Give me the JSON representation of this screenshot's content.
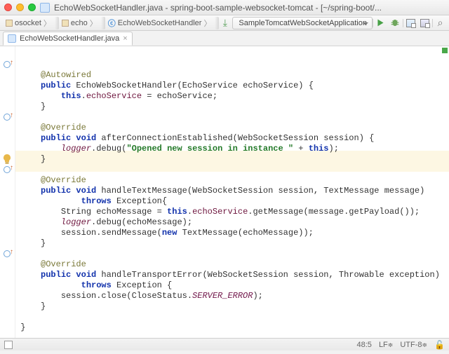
{
  "titlebar": {
    "text": "EchoWebSocketHandler.java - spring-boot-sample-websocket-tomcat - [~/spring-boot/..."
  },
  "breadcrumbs": {
    "b1": "osocket",
    "b2": "echo",
    "b3": "EchoWebSocketHandler"
  },
  "run_config": "SampleTomcatWebSocketApplication",
  "tab": {
    "label": "EchoWebSocketHandler.java"
  },
  "code": {
    "l1_ann": "@Autowired",
    "l2_a": "public",
    "l2_b": " EchoWebSocketHandler(EchoService echoService) {",
    "l3_a": "this",
    "l3_b": ".",
    "l3_c": "echoService",
    "l3_d": " = echoService;",
    "l4": "}",
    "l6_ann": "@Override",
    "l7_a": "public void",
    "l7_b": " afterConnectionEstablished(WebSocketSession session) {",
    "l8_a": "logger",
    "l8_b": ".debug(",
    "l8_c": "\"Opened new session in instance \"",
    "l8_d": " + ",
    "l8_e": "this",
    "l8_f": ");",
    "l9": "}",
    "l11_ann": "@Override",
    "l12_a": "public void",
    "l12_b": " handleTextMessage(WebSocketSession session, TextMessage message)",
    "l13_a": "throws",
    "l13_b": " Exception{",
    "l14_a": "String echoMessage = ",
    "l14_b": "this",
    "l14_c": ".",
    "l14_d": "echoService",
    "l14_e": ".getMessage(message.getPayload());",
    "l15_a": "logger",
    "l15_b": ".debug(echoMessage);",
    "l16_a": "session.sendMessage(",
    "l16_b": "new",
    "l16_c": " TextMessage(echoMessage));",
    "l17": "}",
    "l19_ann": "@Override",
    "l20_a": "public void",
    "l20_b": " handleTransportError(WebSocketSession session, Throwable exception)",
    "l21_a": "throws",
    "l21_b": " Exception {",
    "l22_a": "session.close(CloseStatus.",
    "l22_b": "SERVER_ERROR",
    "l22_c": ");",
    "l23": "}",
    "l25": "}"
  },
  "status": {
    "pos": "48:5",
    "sep": "LF",
    "enc": "UTF-8",
    "ins": ""
  }
}
